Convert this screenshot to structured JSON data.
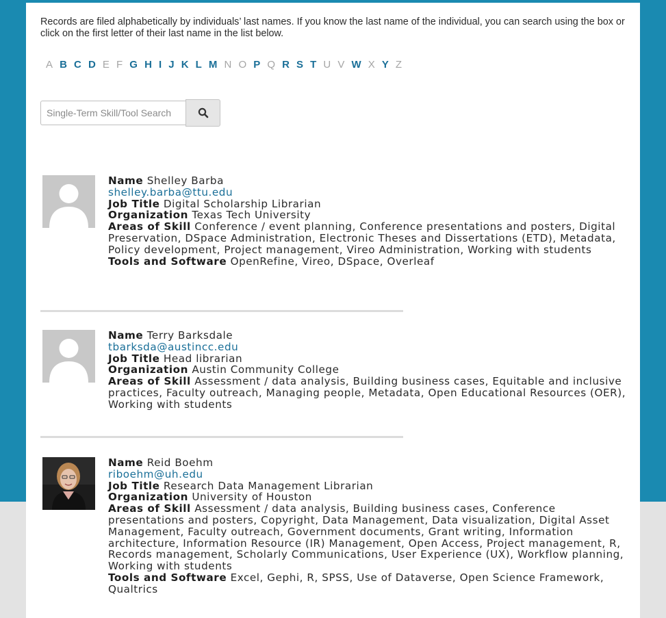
{
  "colors": {
    "brand": "#1a8ab1",
    "link": "#1a6f98",
    "inactive_letter": "#a5a5a5"
  },
  "intro": "Records are filed alphabetically by individuals’ last names. If you know the last name of the individual, you can search using the box or click on the first letter of their last name in the list below.",
  "alphabet": [
    {
      "letter": "A",
      "active": false
    },
    {
      "letter": "B",
      "active": true
    },
    {
      "letter": "C",
      "active": true
    },
    {
      "letter": "D",
      "active": true
    },
    {
      "letter": "E",
      "active": false
    },
    {
      "letter": "F",
      "active": false
    },
    {
      "letter": "G",
      "active": true
    },
    {
      "letter": "H",
      "active": true
    },
    {
      "letter": "I",
      "active": true
    },
    {
      "letter": "J",
      "active": true
    },
    {
      "letter": "K",
      "active": true
    },
    {
      "letter": "L",
      "active": true
    },
    {
      "letter": "M",
      "active": true
    },
    {
      "letter": "N",
      "active": false
    },
    {
      "letter": "O",
      "active": false
    },
    {
      "letter": "P",
      "active": true
    },
    {
      "letter": "Q",
      "active": false
    },
    {
      "letter": "R",
      "active": true
    },
    {
      "letter": "S",
      "active": true
    },
    {
      "letter": "T",
      "active": true
    },
    {
      "letter": "U",
      "active": false
    },
    {
      "letter": "V",
      "active": false
    },
    {
      "letter": "W",
      "active": true
    },
    {
      "letter": "X",
      "active": false
    },
    {
      "letter": "Y",
      "active": true
    },
    {
      "letter": "Z",
      "active": false
    }
  ],
  "search": {
    "placeholder": "Single-Term Skill/Tool Search",
    "value": "",
    "button_icon": "search-icon"
  },
  "labels": {
    "name": "Name",
    "job_title": "Job Title",
    "organization": "Organization",
    "areas": "Areas of Skill",
    "tools": "Tools and Software"
  },
  "records": [
    {
      "name": "Shelley Barba",
      "email": "shelley.barba@ttu.edu",
      "job_title": "Digital Scholarship Librarian",
      "organization": "Texas Tech University",
      "areas": "Conference / event planning, Conference presentations and posters, Digital Preservation, DSpace Administration, Electronic Theses and Dissertations (ETD), Metadata, Policy development, Project management, Vireo Administration, Working with students",
      "tools": "OpenRefine, Vireo, DSpace, Overleaf",
      "photo": "placeholder-avatar"
    },
    {
      "name": "Terry Barksdale",
      "email": "tbarksda@austincc.edu",
      "job_title": "Head librarian",
      "organization": "Austin Community College",
      "areas": "Assessment / data analysis, Building business cases, Equitable and inclusive practices, Faculty outreach, Managing people, Metadata, Open Educational Resources (OER), Working with students",
      "tools": "",
      "photo": "placeholder-avatar"
    },
    {
      "name": "Reid Boehm",
      "email": "riboehm@uh.edu",
      "job_title": "Research Data Management Librarian",
      "organization": "University of Houston",
      "areas": "Assessment / data analysis, Building business cases, Conference presentations and posters, Copyright, Data Management, Data visualization, Digital Asset Management, Faculty outreach, Government documents, Grant writing, Information architecture, Information Resource (IR) Management, Open Access, Project management, R, Records management, Scholarly Communications, User Experience (UX), Workflow planning, Working with students",
      "tools": "Excel, Gephi, R, SPSS, Use of Dataverse, Open Science Framework, Qualtrics",
      "photo": "portrait-photo"
    }
  ]
}
